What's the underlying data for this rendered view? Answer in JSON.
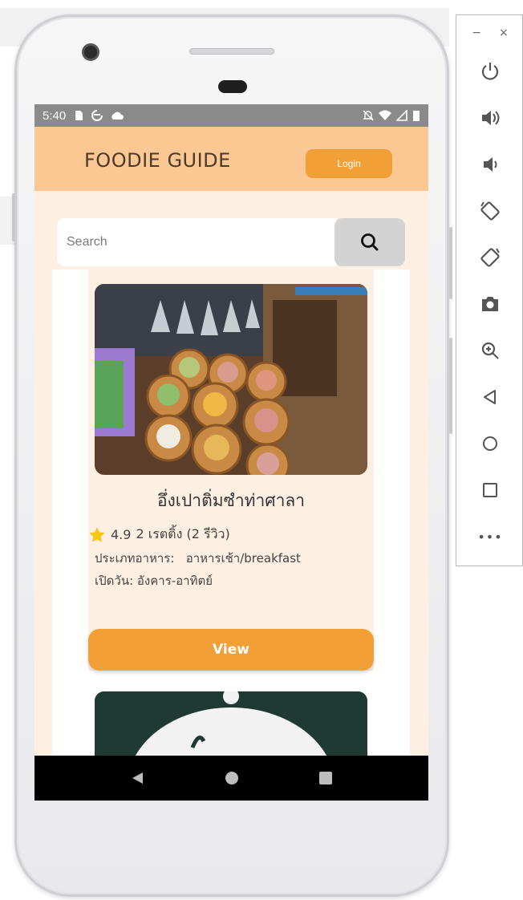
{
  "status_bar": {
    "time": "5:40"
  },
  "app": {
    "title": "FOODIE GUIDE",
    "login_label": "Login"
  },
  "search": {
    "placeholder": "Search"
  },
  "cards": [
    {
      "name": "อึ่งเปาติ่มซำท่าศาลา",
      "rating": "4.9",
      "rating_text": "2 เรตติ้ง (2 รีวิว)",
      "category_label": "ประเภทอาหาร:",
      "category_value": "อาหารเช้า/breakfast",
      "open_label": "เปิดวัน:",
      "open_value": "อังคาร-อาทิตย์",
      "view_label": "View"
    }
  ],
  "colors": {
    "appbar": "#fbc894",
    "accent": "#f0a035",
    "content_bg": "#fdefe2",
    "star": "#f5c518"
  },
  "emulator_controls": {
    "window_minimize": "−",
    "window_close": "×",
    "buttons": [
      "power-icon",
      "volume-up-icon",
      "volume-down-icon",
      "rotate-left-icon",
      "rotate-right-icon",
      "camera-icon",
      "zoom-icon",
      "back-icon",
      "home-icon",
      "overview-icon",
      "more-icon"
    ],
    "more_label": "•••"
  }
}
